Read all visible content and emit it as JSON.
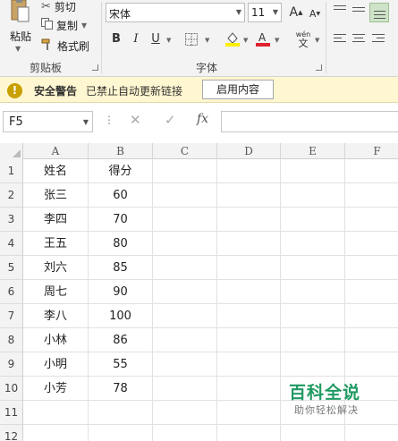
{
  "ribbon": {
    "clipboard": {
      "paste_label": "粘贴",
      "cut_label": "剪切",
      "copy_label": "复制",
      "format_painter_label": "格式刷",
      "group_label": "剪贴板"
    },
    "font": {
      "font_name": "宋体",
      "font_size": "11",
      "bold": "B",
      "italic": "I",
      "underline": "U",
      "grow_font": "A",
      "shrink_font": "A",
      "phonetic_top": "wén",
      "phonetic_bottom": "文",
      "group_label": "字体",
      "font_color_accent": "#e0212f",
      "highlight_accent": "#ffee00"
    }
  },
  "security_bar": {
    "title": "安全警告",
    "message": "已禁止自动更新链接",
    "button_label": "启用内容"
  },
  "formula_bar": {
    "name_box": "F5",
    "dots": "⋮",
    "cancel": "✕",
    "enter": "✓",
    "fx": "fx",
    "formula": ""
  },
  "sheet": {
    "columns": [
      "A",
      "B",
      "C",
      "D",
      "E",
      "F"
    ],
    "rows": [
      {
        "num": "1",
        "a": "姓名",
        "b": "得分"
      },
      {
        "num": "2",
        "a": "张三",
        "b": "60"
      },
      {
        "num": "3",
        "a": "李四",
        "b": "70"
      },
      {
        "num": "4",
        "a": "王五",
        "b": "80"
      },
      {
        "num": "5",
        "a": "刘六",
        "b": "85"
      },
      {
        "num": "6",
        "a": "周七",
        "b": "90"
      },
      {
        "num": "7",
        "a": "李八",
        "b": "100"
      },
      {
        "num": "8",
        "a": "小林",
        "b": "86"
      },
      {
        "num": "9",
        "a": "小明",
        "b": "55"
      },
      {
        "num": "10",
        "a": "小芳",
        "b": "78"
      },
      {
        "num": "11",
        "a": "",
        "b": ""
      },
      {
        "num": "12",
        "a": "",
        "b": ""
      }
    ]
  },
  "watermark": {
    "title": "百科全说",
    "subtitle": "助你轻松解决"
  }
}
